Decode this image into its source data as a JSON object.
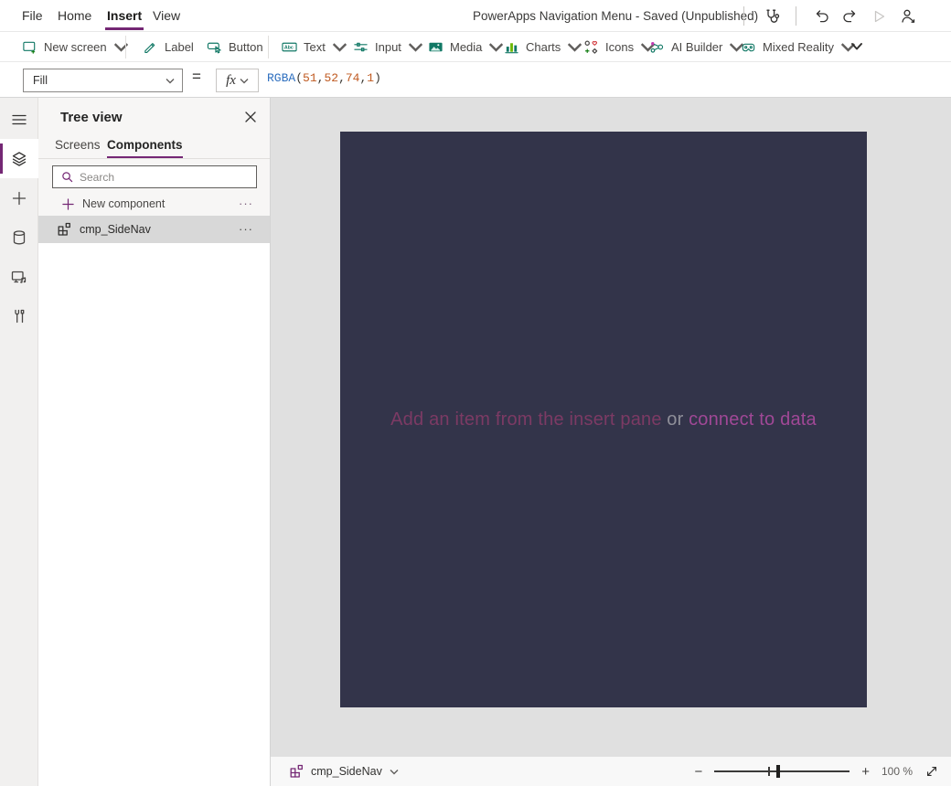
{
  "colors": {
    "accent_purple": "#742774",
    "ribbon_icon_teal": "#117865",
    "canvas_fill": "#33344A",
    "formula_function_color": "#2E6FBF",
    "formula_number_color": "#C05B22",
    "selected_row_gray": "#D8D8D8"
  },
  "menubar": {
    "items": [
      "File",
      "Home",
      "Insert",
      "View"
    ],
    "active_item": "Insert",
    "title": "PowerApps Navigation Menu - Saved (Unpublished)"
  },
  "ribbon": {
    "items": [
      {
        "label": "New screen",
        "dropdown": true
      },
      {
        "label": "Label",
        "dropdown": false
      },
      {
        "label": "Button",
        "dropdown": false
      },
      {
        "label": "Text",
        "dropdown": true
      },
      {
        "label": "Input",
        "dropdown": true
      },
      {
        "label": "Media",
        "dropdown": true
      },
      {
        "label": "Charts",
        "dropdown": true
      },
      {
        "label": "Icons",
        "dropdown": true
      },
      {
        "label": "AI Builder",
        "dropdown": true
      },
      {
        "label": "Mixed Reality",
        "dropdown": true
      }
    ]
  },
  "formula_bar": {
    "property": "Fill",
    "equals_sign": "=",
    "fx_label": "fx",
    "tokens": [
      {
        "text": "RGBA",
        "type": "function"
      },
      {
        "text": "(",
        "type": "plain"
      },
      {
        "text": "51",
        "type": "number"
      },
      {
        "text": ",",
        "type": "plain"
      },
      {
        "text": "52",
        "type": "number"
      },
      {
        "text": ",",
        "type": "plain"
      },
      {
        "text": "74",
        "type": "number"
      },
      {
        "text": ",",
        "type": "plain"
      },
      {
        "text": "1",
        "type": "number"
      },
      {
        "text": ")",
        "type": "plain"
      }
    ]
  },
  "left_rail": {
    "items": [
      "menu",
      "tree-view",
      "insert",
      "data",
      "media",
      "advanced-tools"
    ],
    "active_item": "tree-view"
  },
  "tree_view": {
    "title": "Tree view",
    "tabs": [
      "Screens",
      "Components"
    ],
    "active_tab": "Components",
    "search_placeholder": "Search",
    "new_component_label": "New component",
    "more_glyph": "···",
    "components": [
      {
        "name": "cmp_SideNav",
        "selected": true
      }
    ]
  },
  "canvas": {
    "placeholder_part1": "Add an item from the insert pane",
    "placeholder_or": "or",
    "placeholder_part2": "connect to data"
  },
  "status_bar": {
    "selected_component": "cmp_SideNav",
    "zoom_minus": "−",
    "zoom_plus": "+",
    "zoom_level": "100 %"
  }
}
